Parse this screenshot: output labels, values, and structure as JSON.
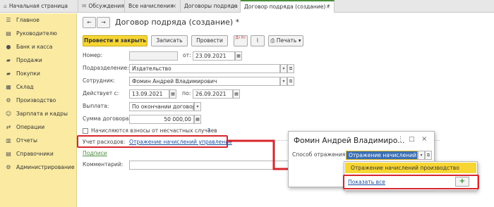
{
  "tabs": [
    {
      "label": "Начальная страница",
      "icon": "home-icon"
    },
    {
      "label": "Обсуждения",
      "icon": "chat-icon"
    },
    {
      "label": "Все начисления"
    },
    {
      "label": "Договоры подряда"
    },
    {
      "label": "Договор подряда (создание) *"
    }
  ],
  "sidebar": {
    "items": [
      {
        "label": "Главное",
        "icon": "menu-icon"
      },
      {
        "label": "Руководителю",
        "icon": "chart-icon"
      },
      {
        "label": "Банк и касса",
        "icon": "bank-icon"
      },
      {
        "label": "Продажи",
        "icon": "sales-icon"
      },
      {
        "label": "Покупки",
        "icon": "purchases-icon"
      },
      {
        "label": "Склад",
        "icon": "warehouse-icon"
      },
      {
        "label": "Производство",
        "icon": "production-icon"
      },
      {
        "label": "Зарплата и кадры",
        "icon": "people-icon"
      },
      {
        "label": "Операции",
        "icon": "operations-icon"
      },
      {
        "label": "Отчеты",
        "icon": "reports-icon"
      },
      {
        "label": "Справочники",
        "icon": "catalog-icon"
      },
      {
        "label": "Администрирование",
        "icon": "gear-icon"
      }
    ]
  },
  "form": {
    "title": "Договор подряда (создание) *",
    "toolbar": {
      "post_close": "Провести и закрыть",
      "save": "Записать",
      "post": "Провести",
      "dtkt": "Дт Кт",
      "print": "Печать"
    },
    "number_label": "Номер:",
    "number_value": "",
    "from_label": "от:",
    "date_value": "23.09.2021",
    "division_label": "Подразделение:",
    "division_value": "Издательство",
    "employee_label": "Сотрудник:",
    "employee_value": "Фомин Андрей Владимирович",
    "valid_from_label": "Действует с:",
    "valid_from_value": "13.09.2021",
    "valid_to_label": "по:",
    "valid_to_value": "26.09.2021",
    "payment_label": "Выплата:",
    "payment_value": "По окончании договора",
    "amount_label": "Сумма договора:",
    "amount_value": "50 000,00",
    "insurance_checkbox": "Начисляются взносы от несчастных случаев",
    "insurance_help": "?",
    "accounting_label": "Учет расходов:",
    "accounting_link": "Отражение начислений управление",
    "signatures_link": "Подписи",
    "comment_label": "Комментарий:",
    "comment_value": ""
  },
  "popup": {
    "title": "Фомин Андрей Владимиро...",
    "reflect_label": "Способ отражения:",
    "reflect_value": "Отражение начислений уп",
    "options": [
      "Отражение начислений производство"
    ],
    "show_all": "Показать все",
    "add": "+"
  },
  "colors": {
    "accent": "#f7d634",
    "sidebar": "#fbeba2",
    "highlight": "#d7262c",
    "link": "#1a4ea1"
  }
}
